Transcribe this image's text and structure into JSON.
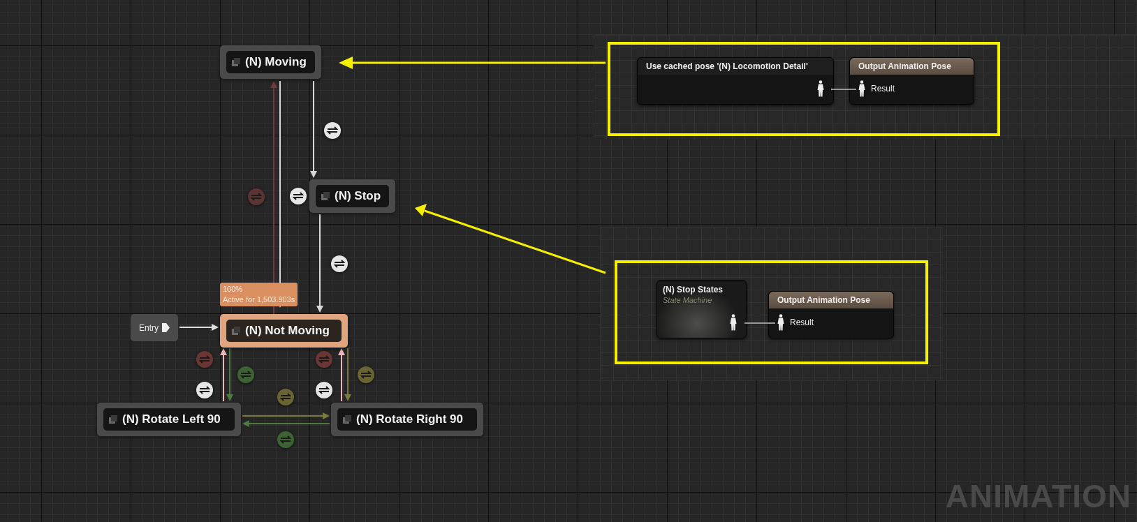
{
  "states": [
    {
      "label": "(N) Moving",
      "active": false
    },
    {
      "label": "(N) Stop",
      "active": false
    },
    {
      "label": "(N) Not Moving",
      "active": true
    },
    {
      "label": "(N) Rotate Left 90",
      "active": false
    },
    {
      "label": "(N) Rotate Right 90",
      "active": false
    }
  ],
  "entry": {
    "label": "Entry"
  },
  "active_tooltip": {
    "weight": "100%",
    "duration": "Active for 1,503.903s"
  },
  "transitions": [
    {
      "color": "#e6e6e6"
    },
    {
      "color": "#5c3434"
    },
    {
      "color": "#e6e6e6"
    },
    {
      "color": "#e6e6e6"
    },
    {
      "color": "#6a3634"
    },
    {
      "color": "#3d6234"
    },
    {
      "color": "#e6e6e6"
    },
    {
      "color": "#6a3634"
    },
    {
      "color": "#6a6434"
    },
    {
      "color": "#e6e6e6"
    },
    {
      "color": "#6a6434"
    },
    {
      "color": "#3d6234"
    }
  ],
  "callouts": [
    {
      "nodes": [
        {
          "kind": "cached_pose",
          "title": "Use cached pose '(N) Locomotion Detail'"
        },
        {
          "kind": "output",
          "title": "Output Animation Pose",
          "pin": "Result"
        }
      ]
    },
    {
      "nodes": [
        {
          "kind": "state_machine",
          "title": "(N) Stop States",
          "subtitle": "State Machine"
        },
        {
          "kind": "output",
          "title": "Output Animation Pose",
          "pin": "Result"
        }
      ]
    }
  ],
  "graph_type_label": "ANIMATION"
}
